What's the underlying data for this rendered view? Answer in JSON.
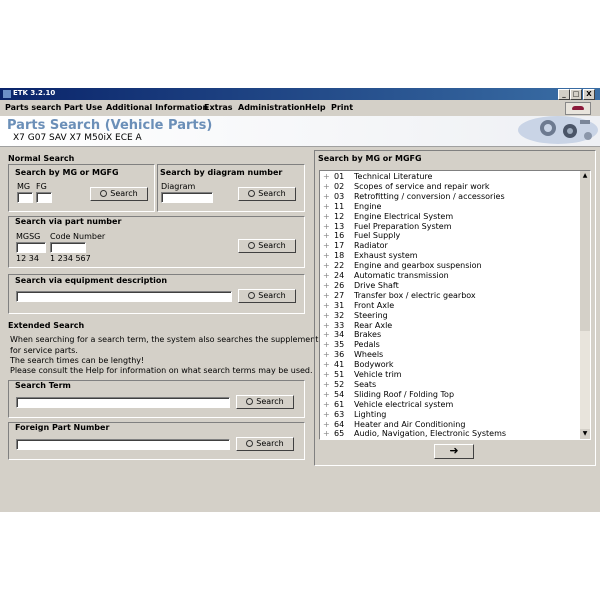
{
  "window": {
    "title": "ETK 3.2.10",
    "minimize": "_",
    "maximize": "□",
    "close": "X"
  },
  "menu": [
    "Parts search",
    "Part Use",
    "Additional Information",
    "Extras",
    "Administration",
    "Help",
    "Print"
  ],
  "header": {
    "title": "Parts Search (Vehicle Parts)",
    "subtitle": "X7 G07 SAV X7 M50iX ECE  A"
  },
  "normal_search": {
    "title": "Normal Search",
    "mg_section": {
      "title": "Search by MG or MGFG",
      "mg_label": "MG",
      "fg_label": "FG",
      "button": "Search"
    },
    "diagram_section": {
      "title": "Search by diagram number",
      "diagram_label": "Diagram",
      "button": "Search"
    },
    "part_section": {
      "title": "Search via part number",
      "mgsg_label": "MGSG",
      "code_label": "Code Number",
      "mgsg_hint": "12 34",
      "code_hint": "1 234 567",
      "button": "Search"
    },
    "equipment_section": {
      "title": "Search via equipment description",
      "button": "Search"
    }
  },
  "extended_search": {
    "title": "Extended Search",
    "info": [
      "When searching for a search term, the system also searches the supplement",
      "for service parts.",
      "The search times can be lengthy!",
      "Please consult the Help for information on what search terms may be used."
    ],
    "term_section": {
      "title": "Search Term",
      "button": "Search"
    },
    "foreign_section": {
      "title": "Foreign Part Number",
      "button": "Search"
    }
  },
  "mg_list": {
    "title": "Search by MG or MGFG",
    "items": [
      {
        "num": "01",
        "label": "Technical Literature"
      },
      {
        "num": "02",
        "label": "Scopes of service and repair work"
      },
      {
        "num": "03",
        "label": "Retrofitting / conversion / accessories"
      },
      {
        "num": "11",
        "label": "Engine"
      },
      {
        "num": "12",
        "label": "Engine Electrical System"
      },
      {
        "num": "13",
        "label": "Fuel Preparation System"
      },
      {
        "num": "16",
        "label": "Fuel Supply"
      },
      {
        "num": "17",
        "label": "Radiator"
      },
      {
        "num": "18",
        "label": "Exhaust system"
      },
      {
        "num": "22",
        "label": "Engine and gearbox suspension"
      },
      {
        "num": "24",
        "label": "Automatic transmission"
      },
      {
        "num": "26",
        "label": "Drive Shaft"
      },
      {
        "num": "27",
        "label": "Transfer box / electric gearbox"
      },
      {
        "num": "31",
        "label": "Front Axle"
      },
      {
        "num": "32",
        "label": "Steering"
      },
      {
        "num": "33",
        "label": "Rear Axle"
      },
      {
        "num": "34",
        "label": "Brakes"
      },
      {
        "num": "35",
        "label": "Pedals"
      },
      {
        "num": "36",
        "label": "Wheels"
      },
      {
        "num": "41",
        "label": "Bodywork"
      },
      {
        "num": "51",
        "label": "Vehicle trim"
      },
      {
        "num": "52",
        "label": "Seats"
      },
      {
        "num": "54",
        "label": "Sliding Roof / Folding Top"
      },
      {
        "num": "61",
        "label": "Vehicle electrical system"
      },
      {
        "num": "63",
        "label": "Lighting"
      },
      {
        "num": "64",
        "label": "Heater and Air Conditioning"
      },
      {
        "num": "65",
        "label": "Audio, Navigation, Electronic Systems"
      }
    ],
    "next_button": "➜"
  }
}
